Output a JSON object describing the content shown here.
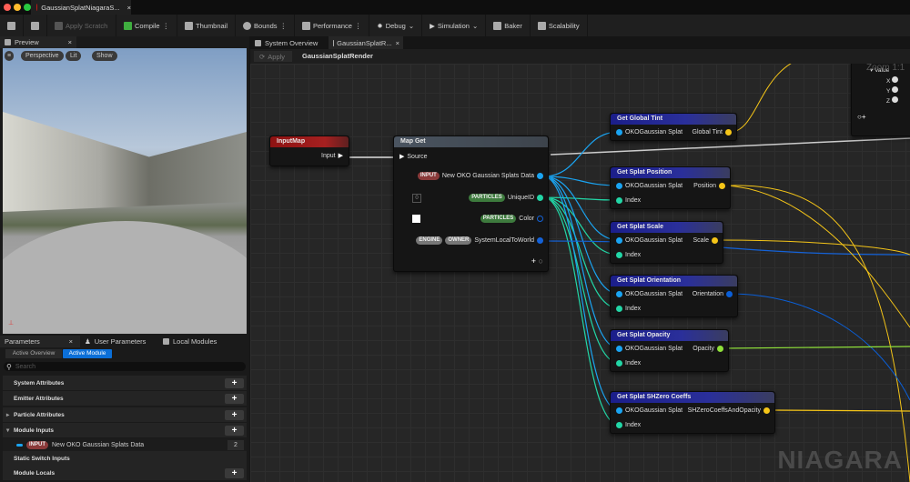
{
  "window": {
    "tab_title": "GaussianSplatNiagaraS..."
  },
  "toolbar": {
    "apply_scratch": "Apply Scratch",
    "compile": "Compile",
    "thumbnail": "Thumbnail",
    "bounds": "Bounds",
    "performance": "Performance",
    "debug": "Debug",
    "simulation": "Simulation",
    "baker": "Baker",
    "scalability": "Scalability"
  },
  "preview": {
    "tab": "Preview",
    "perspective": "Perspective",
    "lit": "Lit",
    "show": "Show"
  },
  "params": {
    "tabs": [
      "Parameters",
      "User Parameters",
      "Local Modules"
    ],
    "subtabs": [
      "Active Overview",
      "Active Module"
    ],
    "search_placeholder": "Search",
    "sections": [
      "System Attributes",
      "Emitter Attributes",
      "Particle Attributes",
      "Module Inputs",
      "Static Switch Inputs",
      "Module Locals"
    ],
    "input_tag": "INPUT",
    "input_name": "New OKO Gaussian Splats Data",
    "input_value": "2"
  },
  "graph": {
    "tabs": [
      "System Overview",
      "GaussianSplatR..."
    ],
    "apply": "Apply",
    "breadcrumb": "GaussianSplatRender",
    "watermark": "NIAGARA",
    "zoom_label": "Zoom 1:1",
    "input_map": {
      "title": "InputMap",
      "pin": "Input"
    },
    "map_get": {
      "title": "Map Get",
      "source": "Source",
      "default_value": "0",
      "outputs": [
        {
          "tags": [
            "INPUT"
          ],
          "name": "New OKO Gaussian Splats Data"
        },
        {
          "tags": [
            "PARTICLES"
          ],
          "name": "UniqueID"
        },
        {
          "tags": [
            "PARTICLES"
          ],
          "name": "Color"
        },
        {
          "tags": [
            "ENGINE",
            "OWNER"
          ],
          "name": "SystemLocalToWorld"
        }
      ]
    },
    "functions": [
      {
        "title": "Get Global Tint",
        "inputs": [
          "OKOGaussian Splat"
        ],
        "output": "Global Tint",
        "color": "#f5c518"
      },
      {
        "title": "Get Splat Position",
        "inputs": [
          "OKOGaussian Splat",
          "Index"
        ],
        "output": "Position",
        "color": "#f5c518"
      },
      {
        "title": "Get Splat Scale",
        "inputs": [
          "OKOGaussian Splat",
          "Index"
        ],
        "output": "Scale",
        "color": "#f5c518"
      },
      {
        "title": "Get Splat Orientation",
        "inputs": [
          "OKOGaussian Splat",
          "Index"
        ],
        "output": "Orientation",
        "color": "#0a5fd8"
      },
      {
        "title": "Get Splat Opacity",
        "inputs": [
          "OKOGaussian Splat",
          "Index"
        ],
        "output": "Opacity",
        "color": "#8fe03a"
      },
      {
        "title": "Get Splat SHZero Coeffs",
        "inputs": [
          "OKOGaussian Splat",
          "Index"
        ],
        "output": "SHZeroCoeffsAndOpacity",
        "color": "#f5c518"
      }
    ],
    "partial_node": {
      "value": "Value",
      "pins": [
        "X",
        "Y",
        "Z"
      ]
    }
  }
}
